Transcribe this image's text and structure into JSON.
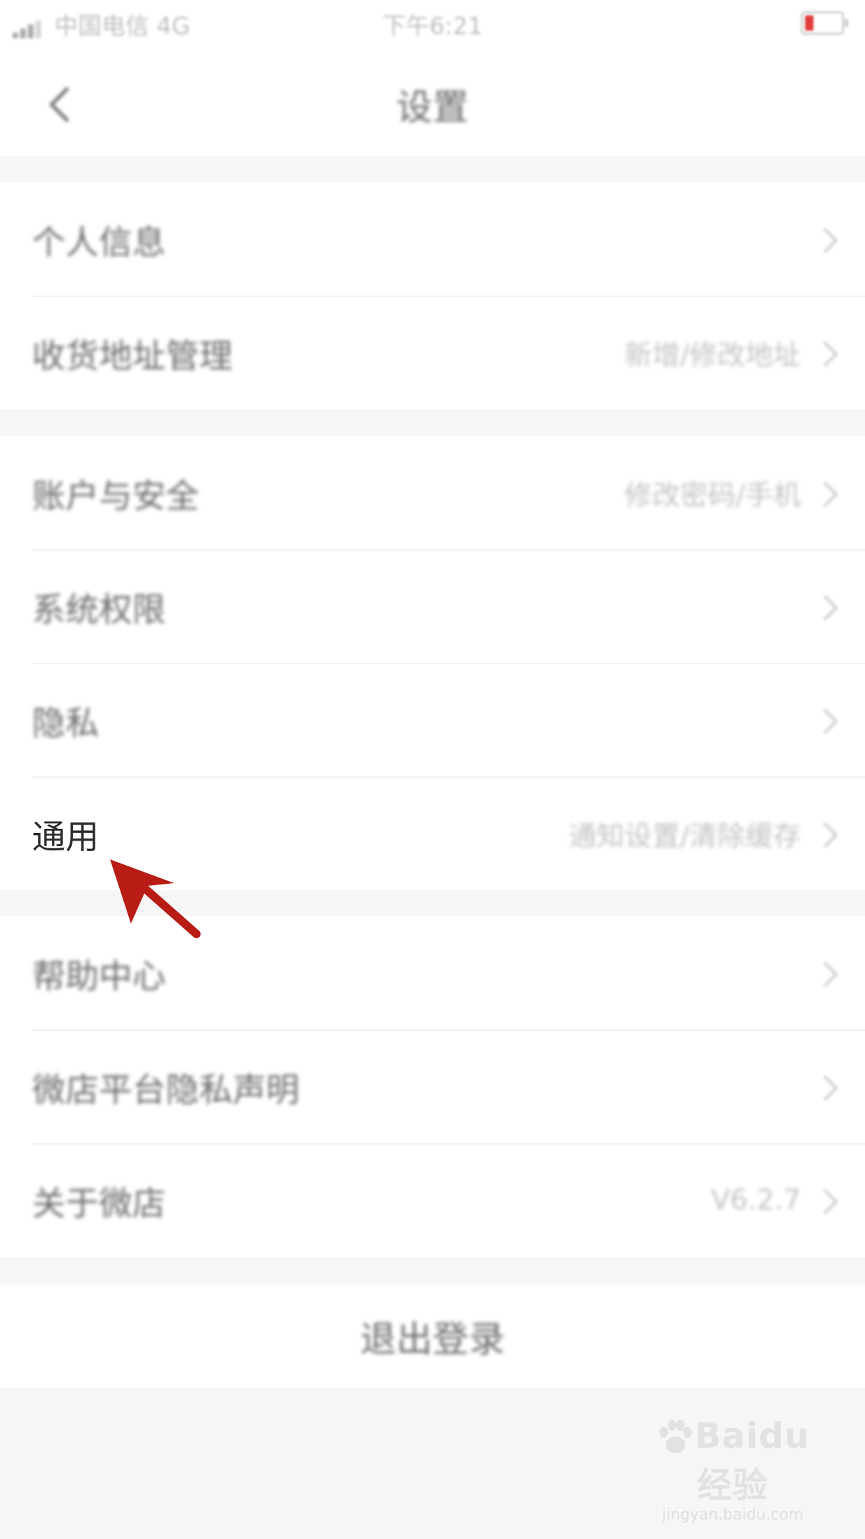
{
  "status_bar": {
    "carrier": "中国电信 4G",
    "time": "下午6:21"
  },
  "nav": {
    "title": "设置"
  },
  "groups": [
    {
      "rows": [
        {
          "label": "个人信息",
          "value": ""
        },
        {
          "label": "收货地址管理",
          "value": "新增/修改地址"
        }
      ]
    },
    {
      "rows": [
        {
          "label": "账户与安全",
          "value": "修改密码/手机"
        },
        {
          "label": "系统权限",
          "value": ""
        },
        {
          "label": "隐私",
          "value": ""
        },
        {
          "label": "通用",
          "value": "通知设置/清除缓存"
        }
      ]
    },
    {
      "rows": [
        {
          "label": "帮助中心",
          "value": ""
        },
        {
          "label": "微店平台隐私声明",
          "value": ""
        },
        {
          "label": "关于微店",
          "value": "V6.2.7"
        }
      ]
    }
  ],
  "logout": {
    "label": "退出登录"
  },
  "annotation": {
    "arrow_color": "#b81c14"
  },
  "watermark": {
    "logo": "Baidu经验",
    "url": "jingyan.baidu.com"
  },
  "icons": {
    "back": "chevron-left-icon",
    "row_arrow": "chevron-right-icon",
    "signal": "signal-icon",
    "battery": "battery-icon",
    "pointer": "red-arrow-icon"
  }
}
